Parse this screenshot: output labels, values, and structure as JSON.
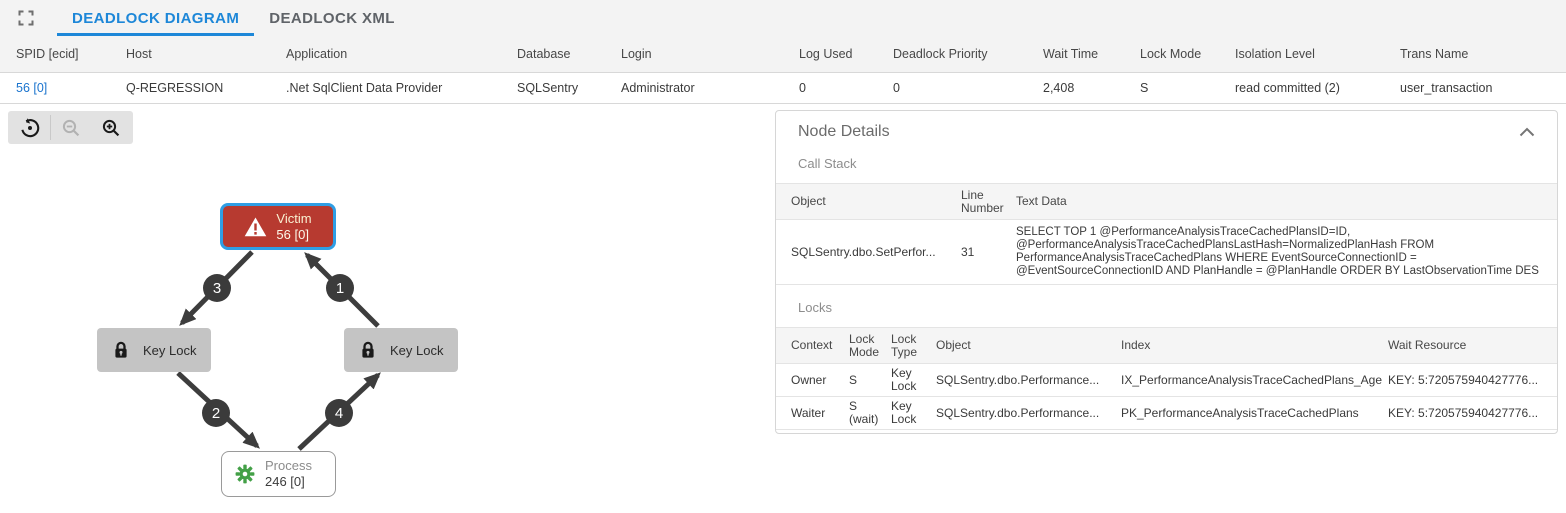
{
  "colors": {
    "accent_blue": "#1d87d8",
    "link_blue": "#1b74ce",
    "victim_red": "#b73a30",
    "selection_blue": "#2e9ee5",
    "resource_gray": "#c4c4c4",
    "edge_dark": "#3d3d3d",
    "process_green": "#43a047"
  },
  "tabbar": {
    "fullscreen_icon": "fullscreen-icon",
    "tabs": [
      {
        "label": "DEADLOCK DIAGRAM",
        "active": true
      },
      {
        "label": "DEADLOCK XML",
        "active": false
      }
    ]
  },
  "session_table": {
    "columns": [
      "SPID [ecid]",
      "Host",
      "Application",
      "Database",
      "Login",
      "Log Used",
      "Deadlock Priority",
      "Wait Time",
      "Lock Mode",
      "Isolation Level",
      "Trans Name"
    ],
    "rows": [
      {
        "spid": "56 [0]",
        "host": "Q-REGRESSION",
        "application": ".Net SqlClient Data Provider",
        "database": "SQLSentry",
        "login": "Administrator",
        "log_used": "0",
        "deadlock_priority": "0",
        "wait_time": "2,408",
        "lock_mode": "S",
        "isolation_level": "read committed (2)",
        "trans_name": "user_transaction"
      }
    ]
  },
  "diagram_toolbar": {
    "buttons": [
      {
        "icon": "reset-zoom-icon",
        "disabled": false
      },
      {
        "icon": "zoom-out-icon",
        "disabled": true
      },
      {
        "icon": "zoom-in-icon",
        "disabled": false
      }
    ]
  },
  "diagram": {
    "nodes": [
      {
        "type": "victim",
        "icon": "warning-icon",
        "title": "Victim",
        "subtitle": "56 [0]",
        "selected": true
      },
      {
        "type": "resource",
        "icon": "lock-icon",
        "title": "Key Lock"
      },
      {
        "type": "resource",
        "icon": "lock-icon",
        "title": "Key Lock"
      },
      {
        "type": "process",
        "icon": "gear-icon",
        "title": "Process",
        "subtitle": "246 [0]"
      }
    ],
    "edge_order_badges": [
      "1",
      "2",
      "3",
      "4"
    ]
  },
  "node_details": {
    "title": "Node Details",
    "collapse_icon": "chevron-up-icon",
    "call_stack": {
      "heading": "Call Stack",
      "columns": [
        "Object",
        "Line Number",
        "Text Data"
      ],
      "rows": [
        {
          "object": "SQLSentry.dbo.SetPerfor...",
          "line_number": "31",
          "text_data": "SELECT TOP 1 @PerformanceAnalysisTraceCachedPlansID=ID, @PerformanceAnalysisTraceCachedPlansLastHash=NormalizedPlanHash FROM PerformanceAnalysisTraceCachedPlans WHERE EventSourceConnectionID = @EventSourceConnectionID AND PlanHandle = @PlanHandle ORDER BY LastObservationTime DES"
        }
      ]
    },
    "locks": {
      "heading": "Locks",
      "columns": [
        "Context",
        "Lock Mode",
        "Lock Type",
        "Object",
        "Index",
        "Wait Resource"
      ],
      "rows": [
        {
          "context": "Owner",
          "lock_mode": "S",
          "lock_type": "Key Lock",
          "object": "SQLSentry.dbo.Performance...",
          "index": "IX_PerformanceAnalysisTraceCachedPlans_Age",
          "wait_resource": "KEY: 5:720575940427776..."
        },
        {
          "context": "Waiter",
          "lock_mode": "S (wait)",
          "lock_type": "Key Lock",
          "object": "SQLSentry.dbo.Performance...",
          "index": "PK_PerformanceAnalysisTraceCachedPlans",
          "wait_resource": "KEY: 5:720575940427776..."
        }
      ]
    }
  }
}
